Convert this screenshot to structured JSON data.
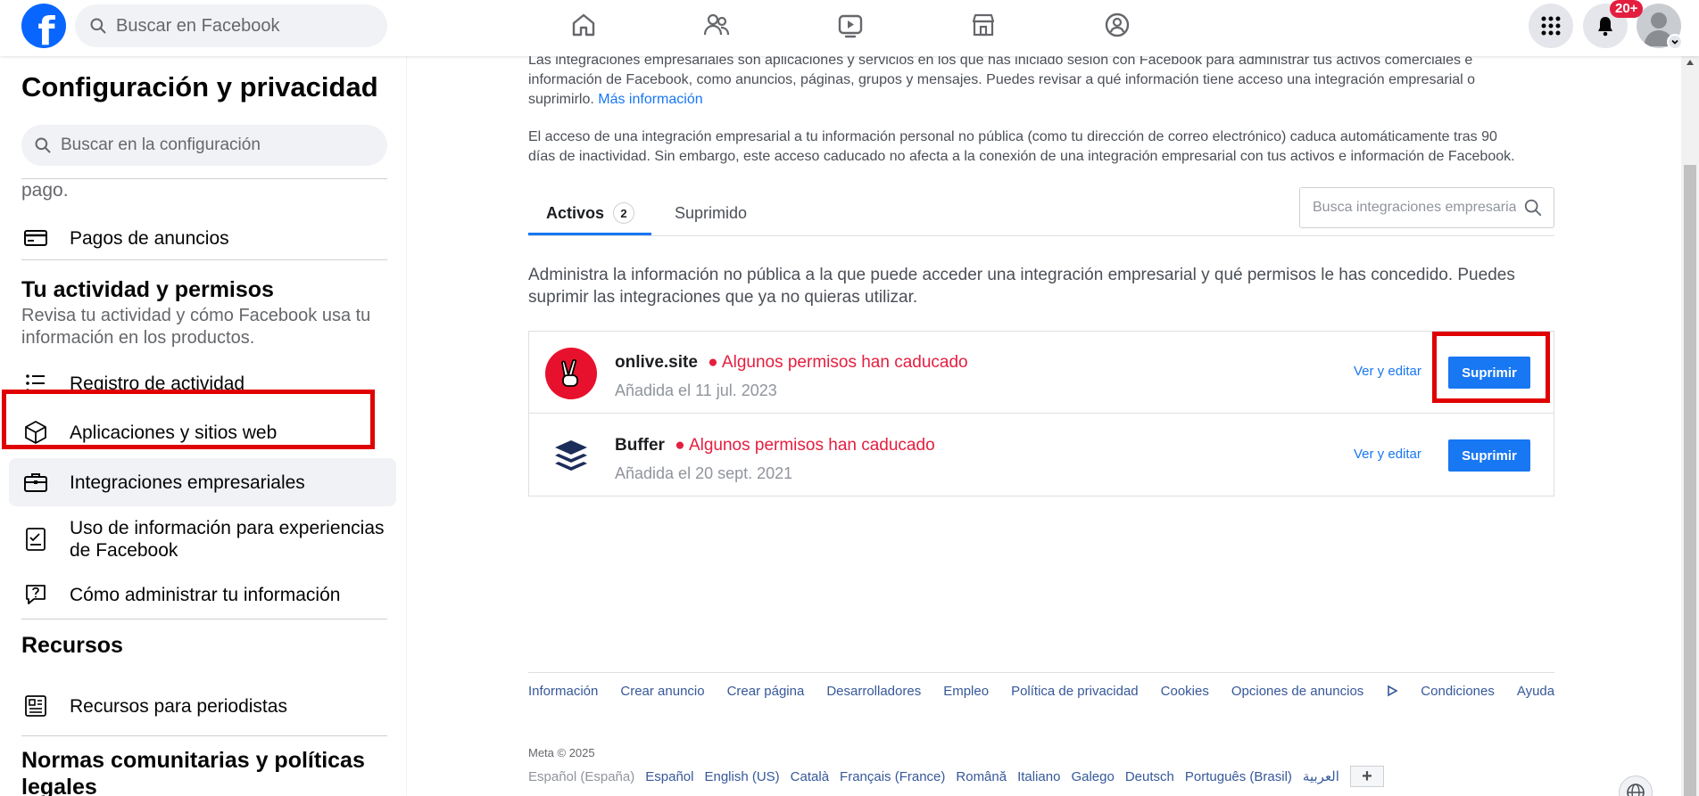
{
  "topbar": {
    "logo_letter": "f",
    "search_placeholder": "Buscar en Facebook",
    "nav_icons": [
      "home-icon",
      "friends-icon",
      "watch-icon",
      "marketplace-icon",
      "groups-icon"
    ],
    "notifications_badge": "20+"
  },
  "sidebar": {
    "title": "Configuración y privacidad",
    "search_placeholder": "Buscar en la configuración",
    "partial_text": "pago.",
    "items_payments": [
      {
        "label": "Pagos de anuncios",
        "icon": "credit-card-icon"
      }
    ],
    "activity_section": {
      "title": "Tu actividad y permisos",
      "description": "Revisa tu actividad y cómo Facebook usa tu información en los productos."
    },
    "activity_items": [
      {
        "label": "Registro de actividad",
        "icon": "list-icon"
      },
      {
        "label": "Aplicaciones y sitios web",
        "icon": "cube-icon"
      },
      {
        "label": "Integraciones empresariales",
        "icon": "briefcase-icon"
      },
      {
        "label": "Uso de información para experiencias de Facebook",
        "icon": "checklist-icon"
      },
      {
        "label": "Cómo administrar tu información",
        "icon": "question-bubble-icon"
      }
    ],
    "resources_section": {
      "title": "Recursos"
    },
    "resources_items": [
      {
        "label": "Recursos para periodistas",
        "icon": "newspaper-icon"
      }
    ],
    "norms_section": {
      "title": "Normas comunitarias y políticas legales"
    }
  },
  "main": {
    "intro_p1": "Las integraciones empresariales son aplicaciones y servicios en los que has iniciado sesión con Facebook para administrar tus activos comerciales e información de Facebook, como anuncios, páginas, grupos y mensajes. Puedes revisar a qué información tiene acceso una integración empresarial o suprimirlo.",
    "intro_link": "Más información",
    "intro_p2": "El acceso de una integración empresarial a tu información personal no pública (como tu dirección de correo electrónico) caduca automáticamente tras 90 días de inactividad. Sin embargo, este acceso caducado no afecta a la conexión de una integración empresarial con tus activos e información de Facebook.",
    "tabs": {
      "active_label": "Activos",
      "active_count": "2",
      "removed_label": "Suprimido"
    },
    "integration_search_placeholder": "Busca integraciones empresariales",
    "admin_text": "Administra la información no pública a la que puede acceder una integración empresarial y qué permisos le has concedido. Puedes suprimir las integraciones que ya no quieras utilizar.",
    "integrations": [
      {
        "name": "onlive.site",
        "warning": "Algunos permisos han caducado",
        "date": "Añadida el 11 jul. 2023",
        "edit_label": "Ver y editar",
        "remove_label": "Suprimir"
      },
      {
        "name": "Buffer",
        "warning": "Algunos permisos han caducado",
        "date": "Añadida el 20 sept. 2021",
        "edit_label": "Ver y editar",
        "remove_label": "Suprimir"
      }
    ],
    "footer_links": [
      "Información",
      "Crear anuncio",
      "Crear página",
      "Desarrolladores",
      "Empleo",
      "Política de privacidad",
      "Cookies",
      "Opciones de anuncios",
      "Condiciones",
      "Ayuda"
    ],
    "meta_copyright": "Meta © 2025",
    "current_language": "Español (España)",
    "languages": [
      "Español",
      "English (US)",
      "Català",
      "Français (France)",
      "Română",
      "Italiano",
      "Galego",
      "Deutsch",
      "Português (Brasil)",
      "العربية"
    ],
    "more_languages": "+"
  },
  "colors": {
    "brand": "#0866ff",
    "link": "#1877f2",
    "warning": "#e41e3f",
    "highlight": "#e00000"
  }
}
